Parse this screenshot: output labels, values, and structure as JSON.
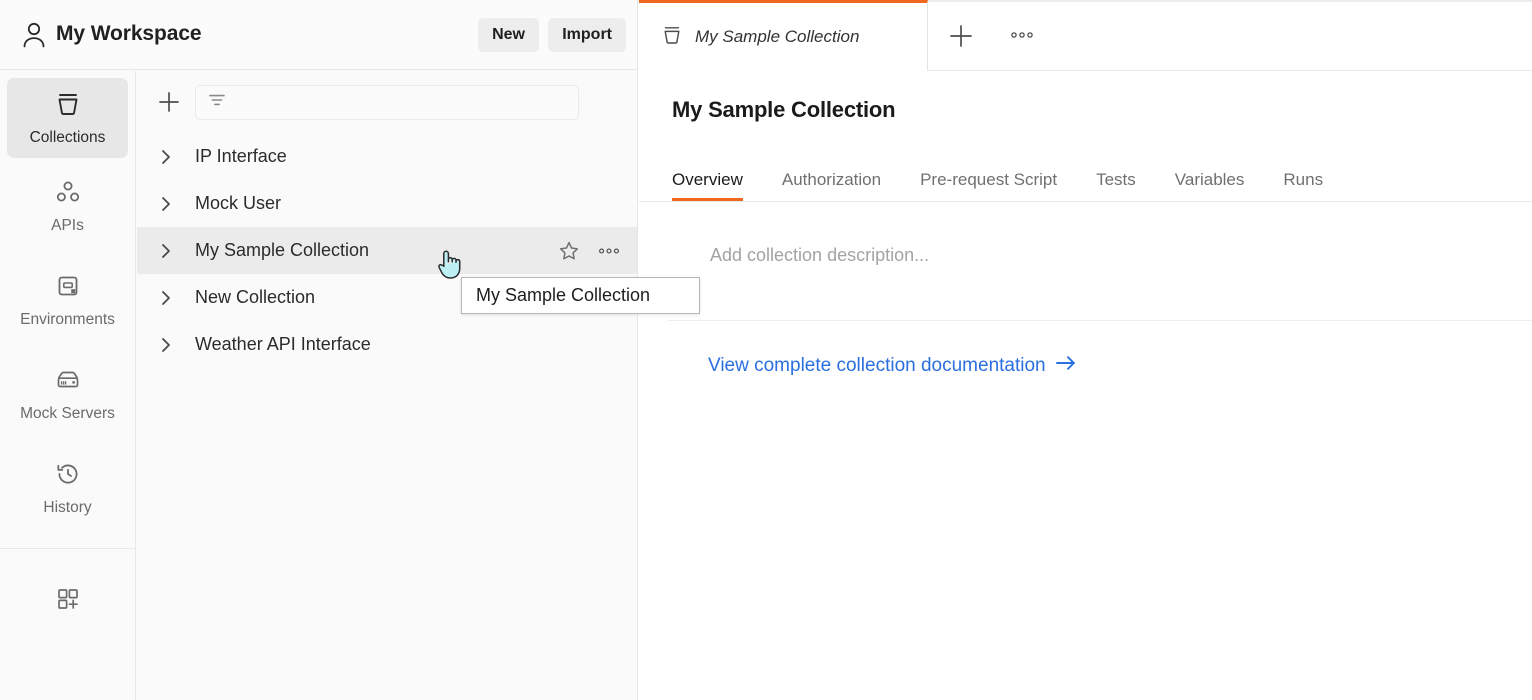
{
  "workspace": {
    "title": "My Workspace",
    "user_icon": "user-icon",
    "new_label": "New",
    "import_label": "Import"
  },
  "rail": {
    "items": [
      {
        "label": "Collections",
        "icon": "collection-icon",
        "active": true
      },
      {
        "label": "APIs",
        "icon": "apis-icon",
        "active": false
      },
      {
        "label": "Environments",
        "icon": "environments-icon",
        "active": false
      },
      {
        "label": "Mock Servers",
        "icon": "mock-servers-icon",
        "active": false
      },
      {
        "label": "History",
        "icon": "history-icon",
        "active": false
      }
    ],
    "apps_icon": "apps-add-icon"
  },
  "collections_panel": {
    "add_icon": "plus-icon",
    "filter_icon": "filter-icon",
    "filter_placeholder": "",
    "more_icon": "more-horizontal-icon",
    "rows": [
      {
        "label": "IP Interface",
        "selected": false
      },
      {
        "label": "Mock User",
        "selected": false
      },
      {
        "label": "My Sample Collection",
        "selected": true
      },
      {
        "label": "New Collection",
        "selected": false
      },
      {
        "label": "Weather API Interface",
        "selected": false
      }
    ],
    "row_actions": {
      "star_icon": "star-icon",
      "more_icon": "more-horizontal-icon"
    }
  },
  "tabstrip": {
    "active_tab": {
      "label": "My Sample Collection",
      "icon": "collection-icon"
    },
    "new_tab_icon": "plus-icon",
    "more_icon": "more-horizontal-icon"
  },
  "detail": {
    "title": "My Sample Collection",
    "tabs": [
      {
        "label": "Overview",
        "active": true
      },
      {
        "label": "Authorization",
        "active": false
      },
      {
        "label": "Pre-request Script",
        "active": false
      },
      {
        "label": "Tests",
        "active": false
      },
      {
        "label": "Variables",
        "active": false
      },
      {
        "label": "Runs",
        "active": false
      }
    ],
    "description_placeholder": "Add collection description...",
    "documentation_link": "View complete collection documentation",
    "documentation_arrow": "arrow-right-icon"
  },
  "tooltip": {
    "text": "My Sample Collection"
  },
  "colors": {
    "accent_orange": "#f0671f",
    "link_blue": "#2a6fe0",
    "selected_row": "#ebebeb",
    "panel_bg": "#fafafa",
    "cursor_fill": "#bdf0f5"
  }
}
